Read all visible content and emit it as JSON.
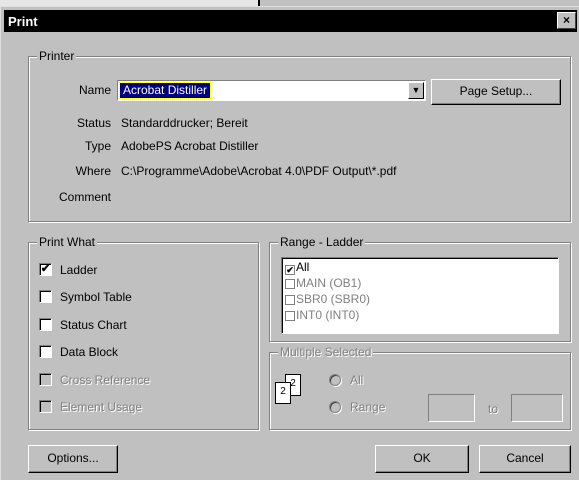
{
  "dialog": {
    "title": "Print",
    "close_glyph": "×"
  },
  "printer": {
    "legend": "Printer",
    "name_label": "Name",
    "name_value": "Acrobat Distiller",
    "dropdown_glyph": "▼",
    "page_setup": "Page Setup...",
    "status_label": "Status",
    "status_value": "Standarddrucker; Bereit",
    "type_label": "Type",
    "type_value": "AdobePS Acrobat Distiller",
    "where_label": "Where",
    "where_value": "C:\\Programme\\Adobe\\Acrobat 4.0\\PDF Output\\*.pdf",
    "comment_label": "Comment",
    "comment_value": ""
  },
  "print_what": {
    "legend": "Print What",
    "items": [
      {
        "label": "Ladder",
        "checked": true,
        "enabled": true
      },
      {
        "label": "Symbol Table",
        "checked": false,
        "enabled": true
      },
      {
        "label": "Status Chart",
        "checked": false,
        "enabled": true
      },
      {
        "label": "Data Block",
        "checked": false,
        "enabled": true
      },
      {
        "label": "Cross Reference",
        "checked": false,
        "enabled": false
      },
      {
        "label": "Element Usage",
        "checked": false,
        "enabled": false
      }
    ],
    "check_glyph": "✔"
  },
  "range": {
    "legend": "Range - Ladder",
    "items": [
      {
        "label": "All",
        "checked": true
      },
      {
        "label": "MAIN (OB1)",
        "checked": false
      },
      {
        "label": "SBR0 (SBR0)",
        "checked": false
      },
      {
        "label": "INT0 (INT0)",
        "checked": false
      }
    ]
  },
  "multiple": {
    "legend": "Multiple Selected",
    "all_label": "All",
    "range_label": "Range",
    "to_label": "to",
    "page_back": "2",
    "page_front": "2"
  },
  "buttons": {
    "options": "Options...",
    "ok": "OK",
    "cancel": "Cancel"
  }
}
